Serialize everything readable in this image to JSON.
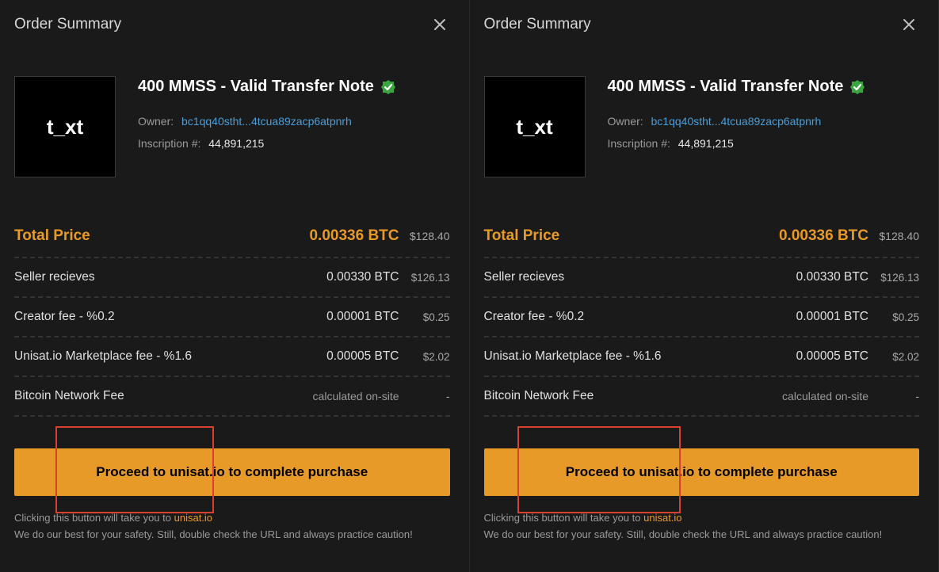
{
  "header": {
    "title": "Order Summary"
  },
  "item": {
    "thumb_text": "t_xt",
    "title": "400 MMSS - Valid Transfer Note",
    "owner_label": "Owner:",
    "owner_value": "bc1qq40stht...4tcua89zacp6atpnrh",
    "inscription_label": "Inscription #:",
    "inscription_value": "44,891,215"
  },
  "rows": {
    "total": {
      "label": "Total Price",
      "btc": "0.00336 BTC",
      "usd": "$128.40"
    },
    "seller": {
      "label": "Seller recieves",
      "btc": "0.00330 BTC",
      "usd": "$126.13"
    },
    "creator": {
      "label": "Creator fee - %0.2",
      "btc": "0.00001 BTC",
      "usd": "$0.25"
    },
    "market": {
      "label": "Unisat.io Marketplace fee - %1.6",
      "btc": "0.00005 BTC",
      "usd": "$2.02"
    },
    "network": {
      "label": "Bitcoin Network Fee",
      "note": "calculated on-site",
      "dash": "-"
    }
  },
  "cta": {
    "label": "Proceed to unisat.io to complete purchase"
  },
  "footer": {
    "line1_pre": "Clicking this button will take you to ",
    "line1_link": "unisat.io",
    "line2": "We do our best for your safety. Still, double check the URL and always practice caution!"
  }
}
